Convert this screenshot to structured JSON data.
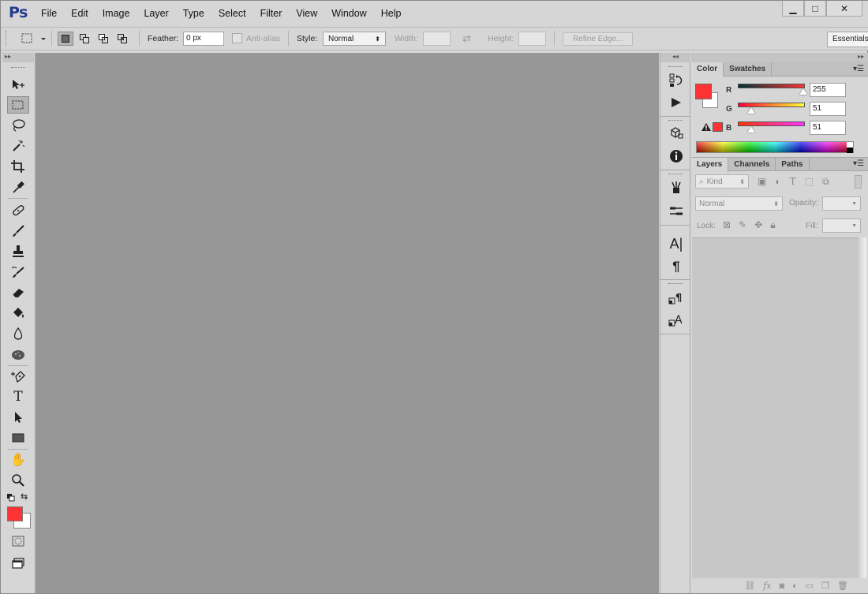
{
  "app": {
    "logo": "Ps"
  },
  "menu": [
    "File",
    "Edit",
    "Image",
    "Layer",
    "Type",
    "Select",
    "Filter",
    "View",
    "Window",
    "Help"
  ],
  "window_controls": {
    "minimize": "▁",
    "maximize": "□",
    "close": "✕"
  },
  "options": {
    "feather_label": "Feather:",
    "feather_value": "0 px",
    "antialias_label": "Anti-alias",
    "style_label": "Style:",
    "style_value": "Normal",
    "width_label": "Width:",
    "height_label": "Height:",
    "refine_edge": "Refine Edge...",
    "workspace": "Essentials"
  },
  "color_panel": {
    "tabs": [
      "Color",
      "Swatches"
    ],
    "r_label": "R",
    "g_label": "G",
    "b_label": "B",
    "r": "255",
    "g": "51",
    "b": "51",
    "foreground": "#ff3333",
    "background": "#ffffff"
  },
  "layers_panel": {
    "tabs": [
      "Layers",
      "Channels",
      "Paths"
    ],
    "kind": "Kind",
    "blend_mode": "Normal",
    "opacity_label": "Opacity:",
    "lock_label": "Lock:",
    "fill_label": "Fill:"
  },
  "colors": {
    "accent_red": "#ff3333",
    "canvas": "#979797"
  }
}
